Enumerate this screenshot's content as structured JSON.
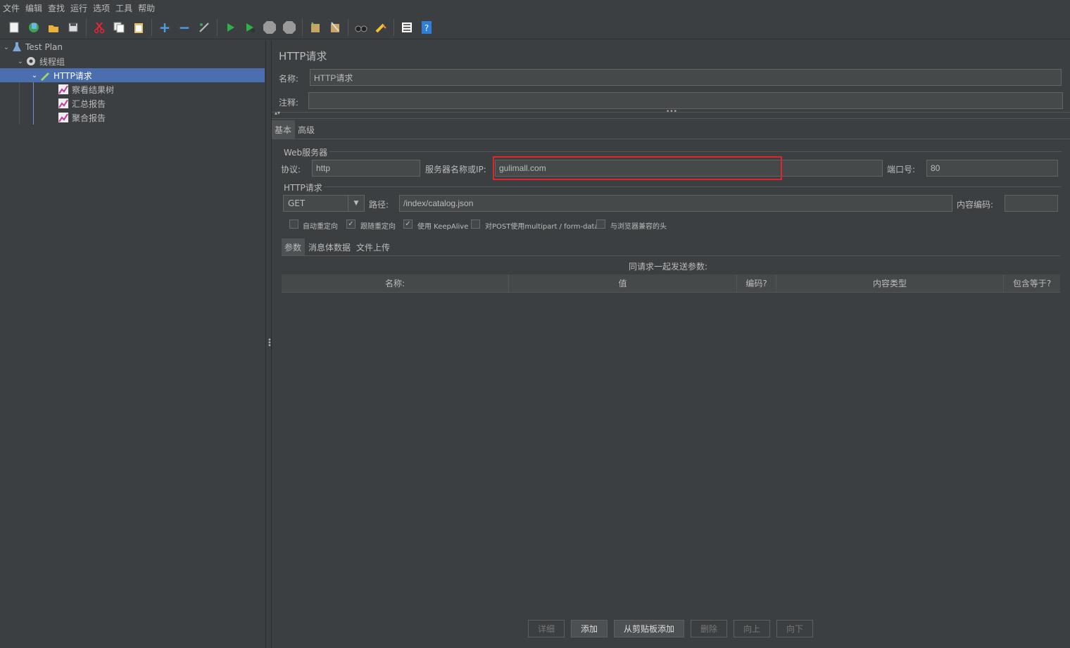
{
  "menu": [
    "文件",
    "编辑",
    "查找",
    "运行",
    "选项",
    "工具",
    "帮助"
  ],
  "toolbar": [
    "new-icon",
    "templates-icon",
    "open-icon",
    "save-icon",
    "cut-icon",
    "copy-icon",
    "paste-icon",
    "expand-icon",
    "collapse-icon",
    "toggle-icon",
    "start-icon",
    "start-no-pause-icon",
    "stop-icon",
    "shutdown-icon",
    "clear-icon",
    "clear-all-icon",
    "search-icon",
    "reset-search-icon",
    "function-helper-icon",
    "help-icon"
  ],
  "tree": {
    "test_plan": "Test Plan",
    "thread_group": "线程组",
    "http_request": "HTTP请求",
    "view_results_tree": "察看结果树",
    "summary_report": "汇总报告",
    "aggregate_report": "聚合报告"
  },
  "panel": {
    "title": "HTTP请求",
    "name_label": "名称:",
    "name_value": "HTTP请求",
    "comment_label": "注释:",
    "comment_value": ""
  },
  "tabs": {
    "basic": "基本",
    "advanced": "高级"
  },
  "web_server": {
    "legend": "Web服务器",
    "protocol_label": "协议:",
    "protocol_value": "http",
    "server_label": "服务器名称或IP:",
    "server_value": "gulimall.com",
    "port_label": "端口号:",
    "port_value": "80"
  },
  "http_request": {
    "legend": "HTTP请求",
    "method": "GET",
    "path_label": "路径:",
    "path_value": "/index/catalog.json",
    "encoding_label": "内容编码:",
    "encoding_value": ""
  },
  "options": [
    {
      "label": "自动重定向",
      "checked": false
    },
    {
      "label": "跟随重定向",
      "checked": true
    },
    {
      "label": "使用 KeepAlive",
      "checked": true
    },
    {
      "label": "对POST使用multipart / form-data",
      "checked": false
    },
    {
      "label": "与浏览器兼容的头",
      "checked": false
    }
  ],
  "subtabs": {
    "params": "参数",
    "body": "消息体数据",
    "files": "文件上传"
  },
  "params": {
    "caption": "同请求一起发送参数:",
    "columns": [
      "名称:",
      "值",
      "编码?",
      "内容类型",
      "包含等于?"
    ]
  },
  "buttons": {
    "detail": "详细",
    "add": "添加",
    "add_clipboard": "从剪贴板添加",
    "delete": "删除",
    "up": "向上",
    "down": "向下"
  },
  "colors": {
    "accent": "#4b6eaf",
    "highlight_box": "#e0262a",
    "background": "#3c3f41"
  }
}
